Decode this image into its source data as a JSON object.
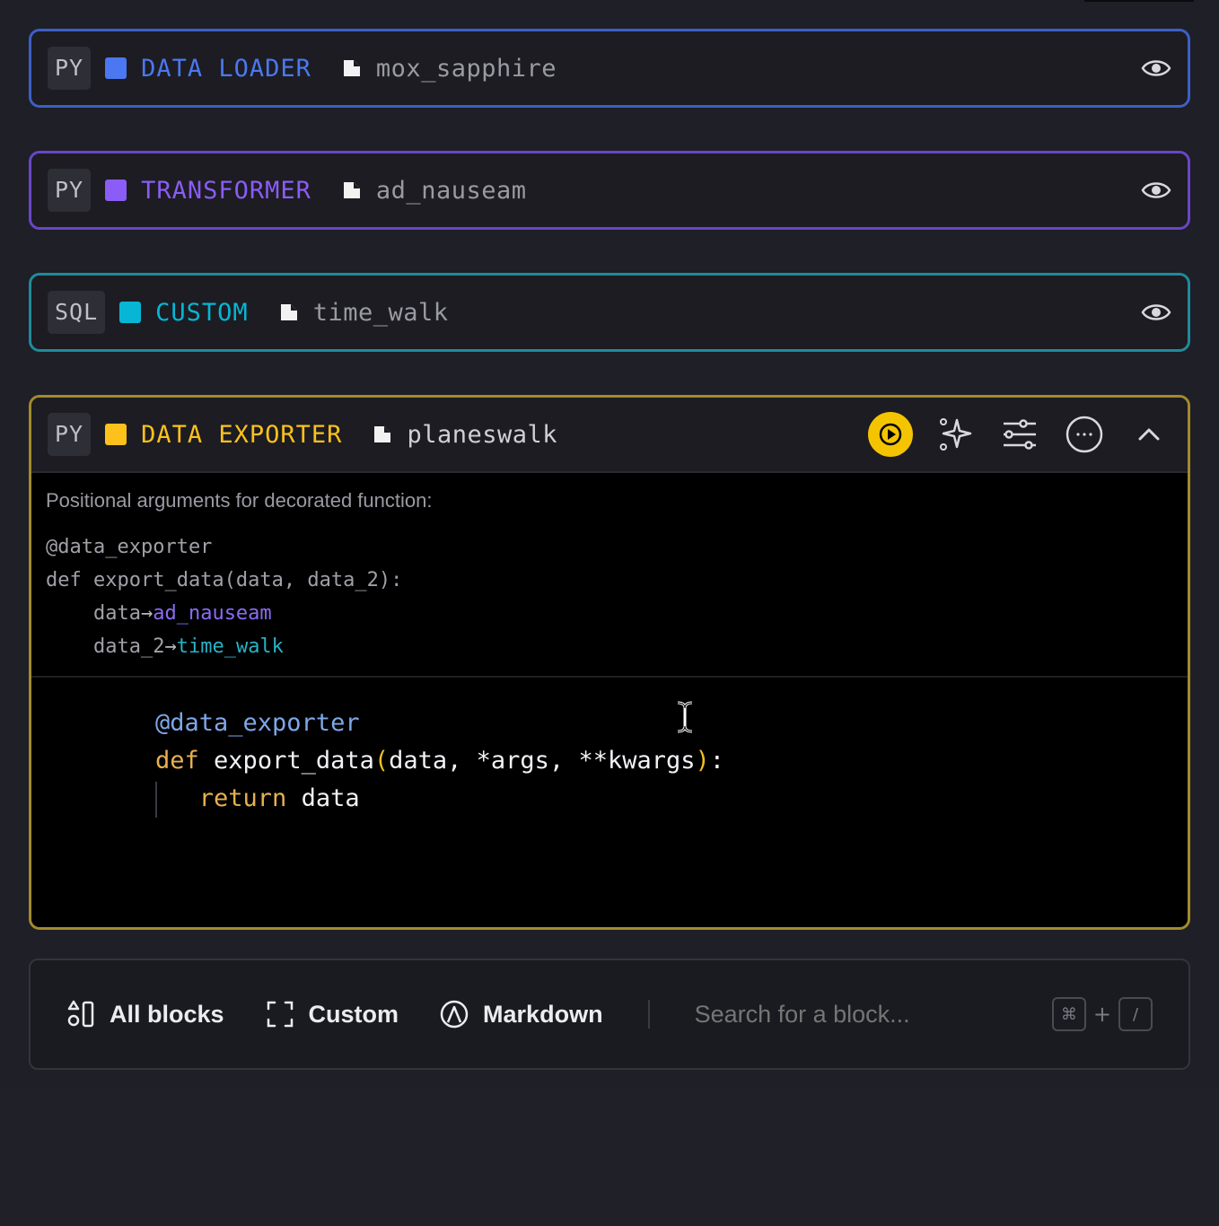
{
  "colors": {
    "data_loader": "#4b78f0",
    "transformer": "#8b5cf6",
    "custom": "#06b6d4",
    "data_exporter": "#fcc21b"
  },
  "blocks": [
    {
      "lang": "PY",
      "type": "DATA LOADER",
      "name": "mox_sapphire"
    },
    {
      "lang": "PY",
      "type": "TRANSFORMER",
      "name": "ad_nauseam"
    },
    {
      "lang": "SQL",
      "type": "CUSTOM",
      "name": "time_walk"
    }
  ],
  "active_block": {
    "lang": "PY",
    "type": "DATA EXPORTER",
    "name": "planeswalk",
    "args_description": "Positional arguments for decorated function:",
    "args_decorator": "@data_exporter",
    "args_signature": "def export_data(data, data_2):",
    "args": [
      {
        "param": "data",
        "arrow": "→",
        "ref": "ad_nauseam"
      },
      {
        "param": "data_2",
        "arrow": "→",
        "ref": "time_walk"
      }
    ],
    "code": {
      "decorator": "@data_exporter",
      "def_kw": "def",
      "fn": "export_data",
      "open_paren": "(",
      "params": "data, *args, **kwargs",
      "close_paren": ")",
      "colon": ":",
      "return_kw": "return",
      "return_val": "data"
    }
  },
  "add_bar": {
    "all_blocks": "All blocks",
    "custom": "Custom",
    "markdown": "Markdown",
    "search_placeholder": "Search for a block...",
    "shortcut_cmd": "⌘",
    "shortcut_plus": "+",
    "shortcut_key": "/"
  }
}
